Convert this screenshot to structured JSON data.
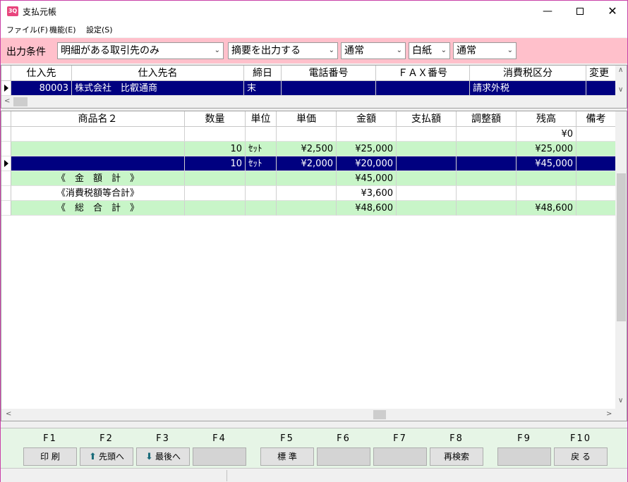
{
  "window": {
    "title": "支払元帳",
    "icon_text": "3Q"
  },
  "menu": [
    {
      "label": "ファイル(F)"
    },
    {
      "label": "機能(E)"
    },
    {
      "label": "設定(S)"
    }
  ],
  "filters": {
    "label": "出力条件",
    "options": [
      {
        "value": "明細がある取引先のみ"
      },
      {
        "value": "摘要を出力する"
      },
      {
        "value": "通常"
      },
      {
        "value": "白紙"
      },
      {
        "value": "通常"
      }
    ]
  },
  "supplier_grid": {
    "headers": [
      "仕入先",
      "仕入先名",
      "締日",
      "電話番号",
      "ＦＡＸ番号",
      "消費税区分",
      "変更"
    ],
    "row": {
      "code": "80003",
      "name": "株式会社　比叡通商",
      "closing": "末",
      "phone": "",
      "fax": "",
      "tax": "請求外税",
      "changed": ""
    }
  },
  "ledger_grid": {
    "headers": [
      "商品名２",
      "数量",
      "単位",
      "単価",
      "金額",
      "支払額",
      "調整額",
      "残高",
      "備考"
    ],
    "rows": [
      {
        "name": "",
        "qty": "",
        "unit": "",
        "price": "",
        "amount": "",
        "paid": "",
        "adjust": "",
        "balance": "¥0",
        "note": ""
      },
      {
        "name": "",
        "qty": "10",
        "unit": "ｾｯﾄ",
        "price": "¥2,500",
        "amount": "¥25,000",
        "paid": "",
        "adjust": "",
        "balance": "¥25,000",
        "note": ""
      },
      {
        "name": "",
        "qty": "10",
        "unit": "ｾｯﾄ",
        "price": "¥2,000",
        "amount": "¥20,000",
        "paid": "",
        "adjust": "",
        "balance": "¥45,000",
        "note": ""
      },
      {
        "name": "《　金　額　計　》",
        "qty": "",
        "unit": "",
        "price": "",
        "amount": "¥45,000",
        "paid": "",
        "adjust": "",
        "balance": "",
        "note": ""
      },
      {
        "name": "《消費税額等合計》",
        "qty": "",
        "unit": "",
        "price": "",
        "amount": "¥3,600",
        "paid": "",
        "adjust": "",
        "balance": "",
        "note": ""
      },
      {
        "name": "《　総　合　計　》",
        "qty": "",
        "unit": "",
        "price": "",
        "amount": "¥48,600",
        "paid": "",
        "adjust": "",
        "balance": "¥48,600",
        "note": ""
      }
    ]
  },
  "function_keys": [
    {
      "key": "F1",
      "label": "印 刷"
    },
    {
      "key": "F2",
      "label": "先頭へ",
      "icon": "arrow-up-icon"
    },
    {
      "key": "F3",
      "label": "最後へ",
      "icon": "arrow-down-icon"
    },
    {
      "key": "F4",
      "label": ""
    },
    {
      "key": "F5",
      "label": "標 準"
    },
    {
      "key": "F6",
      "label": ""
    },
    {
      "key": "F7",
      "label": ""
    },
    {
      "key": "F8",
      "label": "再検索"
    },
    {
      "key": "F9",
      "label": ""
    },
    {
      "key": "F10",
      "label": "戻 る"
    }
  ],
  "colors": {
    "selected_row": "#000080",
    "total_row": "#c8f5c8",
    "filter_bar": "#ffc0cb",
    "fkey_bar": "#e6f5e6"
  }
}
